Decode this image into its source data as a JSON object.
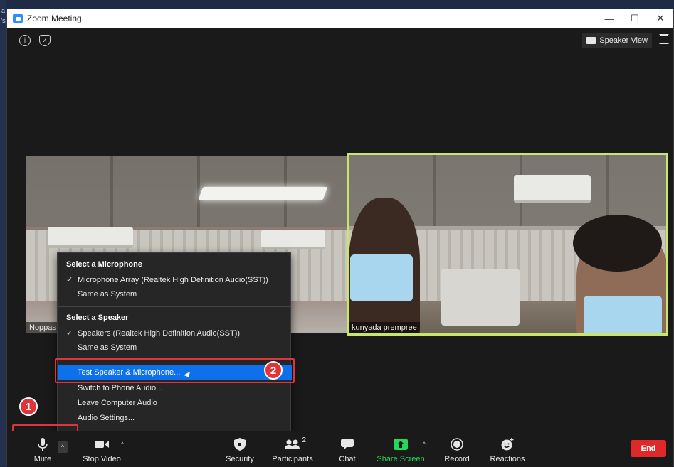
{
  "window": {
    "title": "Zoom Meeting",
    "minimize_glyph": "—",
    "maximize_glyph": "☐",
    "close_glyph": "✕"
  },
  "desktop": {
    "edge_text": "a\n's"
  },
  "meeting": {
    "speaker_view_label": "Speaker View",
    "participants": [
      {
        "name": "Noppas"
      },
      {
        "name": "kunyada prempree"
      }
    ]
  },
  "audio_menu": {
    "microphone_header": "Select a Microphone",
    "microphone_options": [
      {
        "label": "Microphone Array (Realtek High Definition Audio(SST))",
        "checked": true
      },
      {
        "label": "Same as System",
        "checked": false
      }
    ],
    "speaker_header": "Select a Speaker",
    "speaker_options": [
      {
        "label": "Speakers (Realtek High Definition Audio(SST))",
        "checked": true
      },
      {
        "label": "Same as System",
        "checked": false
      }
    ],
    "test_label": "Test Speaker & Microphone...",
    "phone_label": "Switch to Phone Audio...",
    "leave_label": "Leave Computer Audio",
    "settings_label": "Audio Settings...",
    "check_glyph": "✓"
  },
  "annotations": {
    "badge_1": "1",
    "badge_2": "2",
    "highlight_color": "#e0343a"
  },
  "toolbar": {
    "mute_label": "Mute",
    "stop_video_label": "Stop Video",
    "security_label": "Security",
    "participants_label": "Participants",
    "participants_count": "2",
    "chat_label": "Chat",
    "share_screen_label": "Share Screen",
    "record_label": "Record",
    "reactions_label": "Reactions",
    "end_label": "End",
    "caret_glyph": "^",
    "share_color": "#23d959",
    "end_color": "#e02828",
    "active_tile_border": "#c8e66b",
    "menu_highlight": "#0e71eb"
  }
}
